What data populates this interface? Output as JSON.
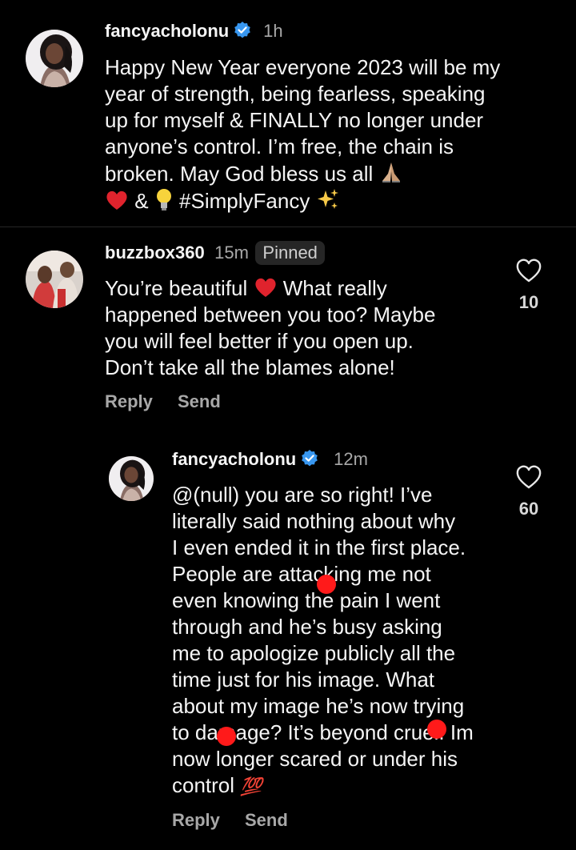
{
  "post": {
    "username": "fancyacholonu",
    "time": "1h",
    "lines": [
      "Happy New Year everyone 2023 will be my",
      "year of strength, being fearless, speaking",
      "up for myself & FINALLY no longer under",
      "anyone’s control. I’m free, the chain is",
      "broken. May God bless us all"
    ],
    "last_line_amp": "&",
    "hashtag": "#SimplyFancy"
  },
  "comment": {
    "username": "buzzbox360",
    "time": "15m",
    "pinned_label": "Pinned",
    "line1": "You’re beautiful",
    "line1_tail": "What really",
    "lines": [
      "happened between you too? Maybe",
      "you will feel better if you open up.",
      "Don’t take all the blames alone!"
    ],
    "like_count": "10",
    "reply_label": "Reply",
    "send_label": "Send"
  },
  "reply": {
    "username": "fancyacholonu",
    "time": "12m",
    "lines": [
      "@(null) you are so right! I’ve",
      "literally said nothing about why",
      "I even ended it in the first place.",
      "People are attacking me not",
      "even knowing the pain I went",
      "through and he’s busy asking",
      "me to apologize publicly all the",
      "time just for his image. What",
      "about my image he’s now trying",
      "to damage? It’s beyond cruel. Im",
      "now longer scared or under his"
    ],
    "last_line": "control",
    "last_emoji": "💯",
    "like_count": "60",
    "reply_label": "Reply",
    "send_label": "Send"
  },
  "colors": {
    "background": "#000000",
    "text": "#f5f5f5",
    "muted": "#a8a8a8",
    "verified": "#3897f0",
    "redaction": "#ff1a1a"
  }
}
